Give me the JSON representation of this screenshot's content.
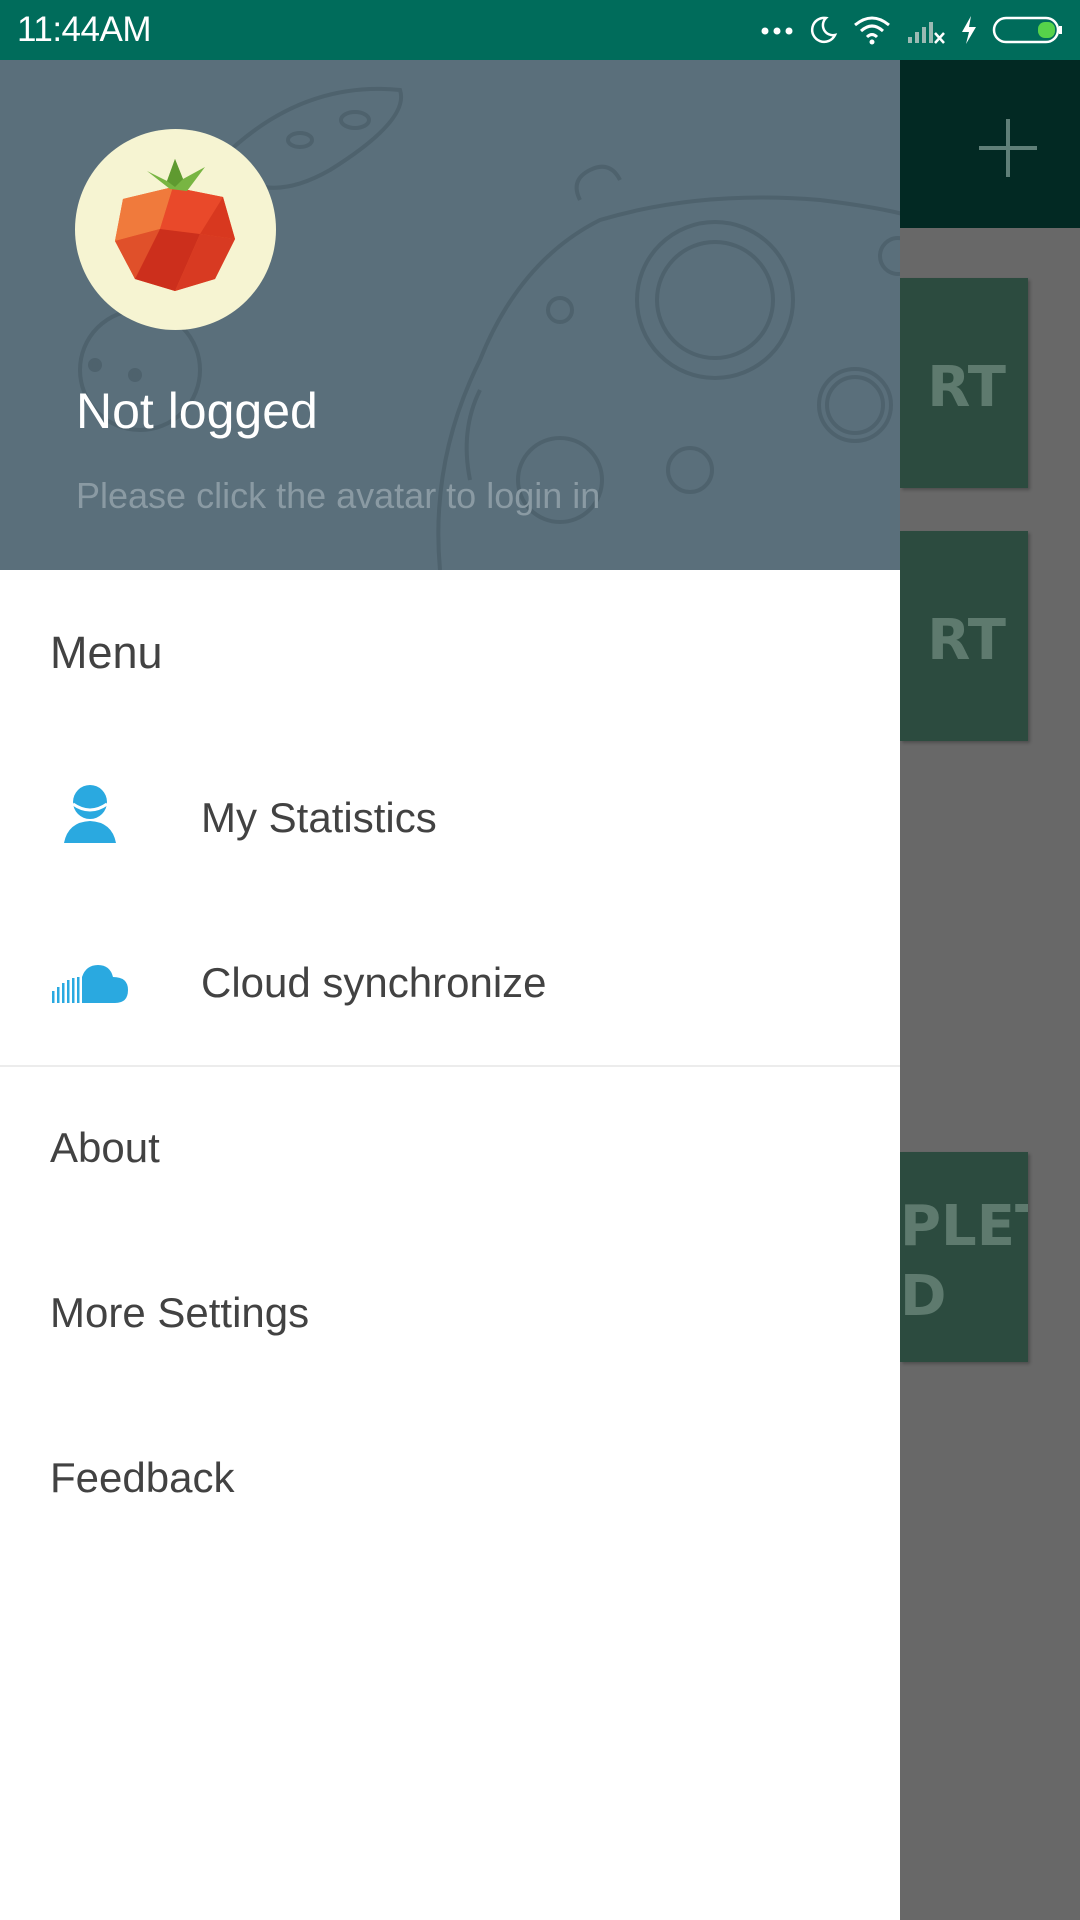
{
  "status_bar": {
    "time": "11:44AM",
    "icons": [
      "more-dots-icon",
      "moon-icon",
      "wifi-icon",
      "signal-icon",
      "charging-icon",
      "battery-icon"
    ]
  },
  "background_app": {
    "cards": [
      {
        "label": "RT"
      },
      {
        "label": "RT"
      },
      {
        "label": "PLET\nD"
      }
    ]
  },
  "drawer": {
    "header": {
      "user_name": "Not logged",
      "hint": "Please click the avatar to login in"
    },
    "menu_title": "Menu",
    "menu_items": [
      {
        "label": "My Statistics",
        "icon": "user-icon"
      },
      {
        "label": "Cloud synchronize",
        "icon": "cloud-icon"
      }
    ],
    "extra_items": [
      {
        "label": "About"
      },
      {
        "label": "More Settings"
      },
      {
        "label": "Feedback"
      }
    ]
  },
  "colors": {
    "status_bar": "#006c5b",
    "toolbar": "#022923",
    "drawer_header": "#5a6f7b",
    "accent_icon": "#2aa9e0",
    "text_primary": "#424242"
  }
}
